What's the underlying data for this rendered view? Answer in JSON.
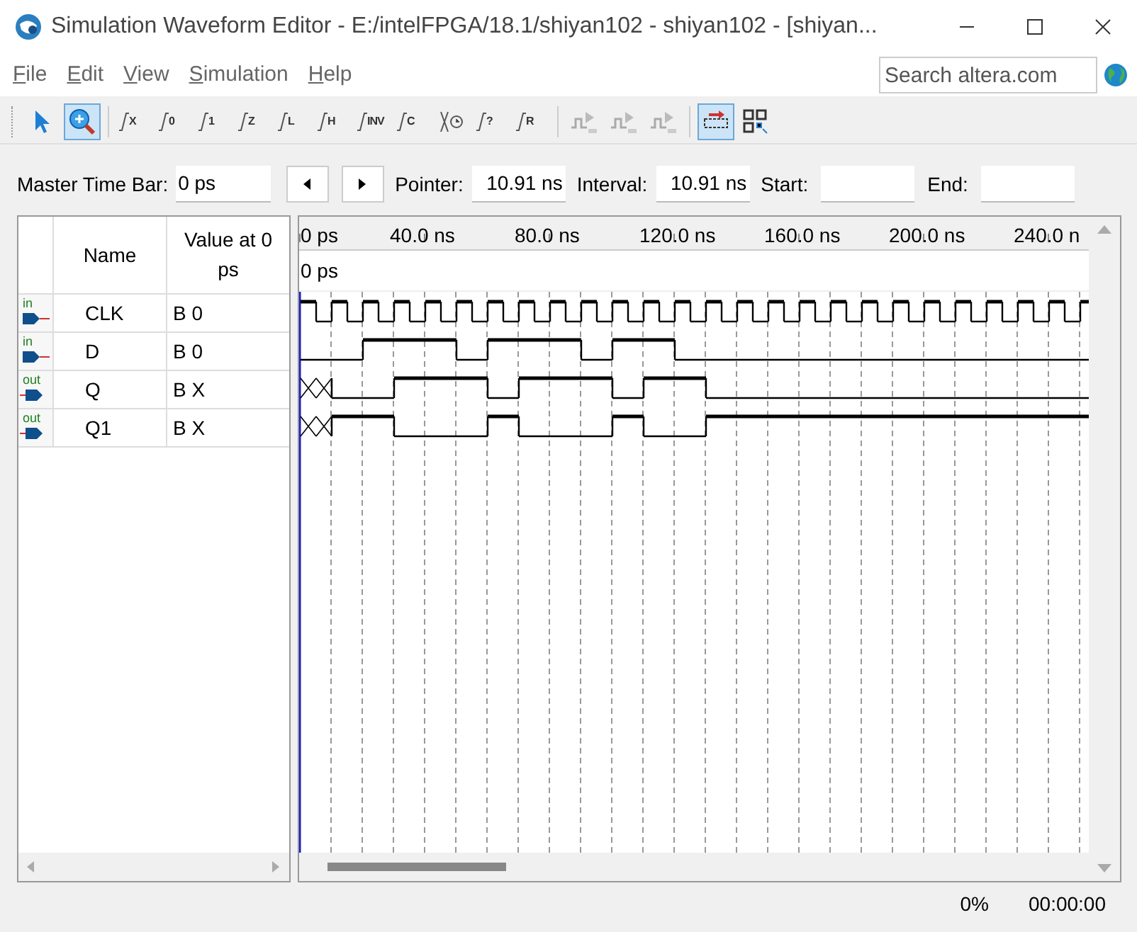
{
  "window": {
    "title": "Simulation Waveform Editor - E:/intelFPGA/18.1/shiyan102 - shiyan102 - [shiyan..."
  },
  "menu": [
    {
      "label": "File"
    },
    {
      "label": "Edit"
    },
    {
      "label": "View"
    },
    {
      "label": "Simulation"
    },
    {
      "label": "Help"
    }
  ],
  "search": {
    "placeholder": "Search altera.com"
  },
  "toolbar": [
    {
      "kind": "pointer",
      "selected": false
    },
    {
      "kind": "zoom",
      "selected": true
    },
    {
      "kind": "sep"
    },
    {
      "kind": "glyph",
      "label": "X",
      "selected": false
    },
    {
      "kind": "glyph",
      "label": "0",
      "selected": false
    },
    {
      "kind": "glyph",
      "label": "1",
      "selected": false
    },
    {
      "kind": "glyph",
      "label": "Z",
      "selected": false
    },
    {
      "kind": "glyph",
      "label": "L",
      "selected": false
    },
    {
      "kind": "glyph",
      "label": "H",
      "selected": false
    },
    {
      "kind": "glyph",
      "label": "INV",
      "selected": false
    },
    {
      "kind": "glyph",
      "label": "C",
      "selected": false
    },
    {
      "kind": "count",
      "selected": false
    },
    {
      "kind": "glyph",
      "label": "?",
      "selected": false
    },
    {
      "kind": "glyph",
      "label": "R",
      "selected": false
    },
    {
      "kind": "sep"
    },
    {
      "kind": "run",
      "selected": false
    },
    {
      "kind": "run",
      "selected": false
    },
    {
      "kind": "run",
      "selected": false
    },
    {
      "kind": "sep"
    },
    {
      "kind": "snap",
      "selected": true
    },
    {
      "kind": "grid",
      "selected": false
    }
  ],
  "time_bar": {
    "master_label": "Master Time Bar:",
    "master_value": "0 ps",
    "pointer_label": "Pointer:",
    "pointer_value": "10.91 ns",
    "interval_label": "Interval:",
    "interval_value": "10.91 ns",
    "start_label": "Start:",
    "end_label": "End:"
  },
  "columns": [
    "Name",
    "Value at 0 ps"
  ],
  "signals": [
    {
      "kind": "in",
      "port_label": "in",
      "name": "CLK",
      "value": "B 0"
    },
    {
      "kind": "in",
      "port_label": "in",
      "name": "D",
      "value": "B 0"
    },
    {
      "kind": "out",
      "port_label": "out",
      "name": "Q",
      "value": "B X"
    },
    {
      "kind": "out",
      "port_label": "out",
      "name": "Q1",
      "value": "B X"
    }
  ],
  "ruler": {
    "ticks": [
      "0 ps",
      "40.0 ns",
      "80.0 ns",
      "120.0 ns",
      "160.0 ns",
      "200.0 ns",
      "240.0 n"
    ],
    "cursor_label": "0 ps"
  },
  "status": {
    "progress": "0%",
    "elapsed": "00:00:00"
  }
}
